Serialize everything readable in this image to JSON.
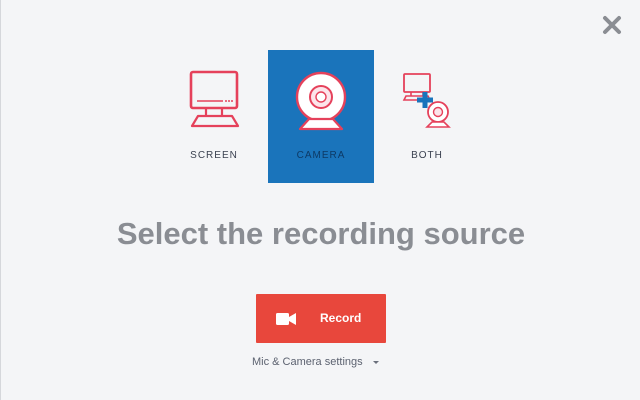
{
  "colors": {
    "accent": "#e8473c",
    "selected_bg": "#1a74bb",
    "icon_red": "#e5415b",
    "heading_gray": "#8a8d93"
  },
  "dialog": {
    "close_icon": "close-icon",
    "sources": [
      {
        "id": "screen",
        "label": "SCREEN",
        "icon": "monitor-icon",
        "selected": false
      },
      {
        "id": "camera",
        "label": "CAMERA",
        "icon": "webcam-icon",
        "selected": true
      },
      {
        "id": "both",
        "label": "BOTH",
        "icon": "monitor-plus-webcam-icon",
        "selected": false
      }
    ],
    "headline": "Select the recording source",
    "record_button": {
      "label": "Record",
      "icon": "video-camera-icon"
    },
    "settings_link": {
      "label": "Mic & Camera settings",
      "icon": "caret-down-icon"
    }
  }
}
